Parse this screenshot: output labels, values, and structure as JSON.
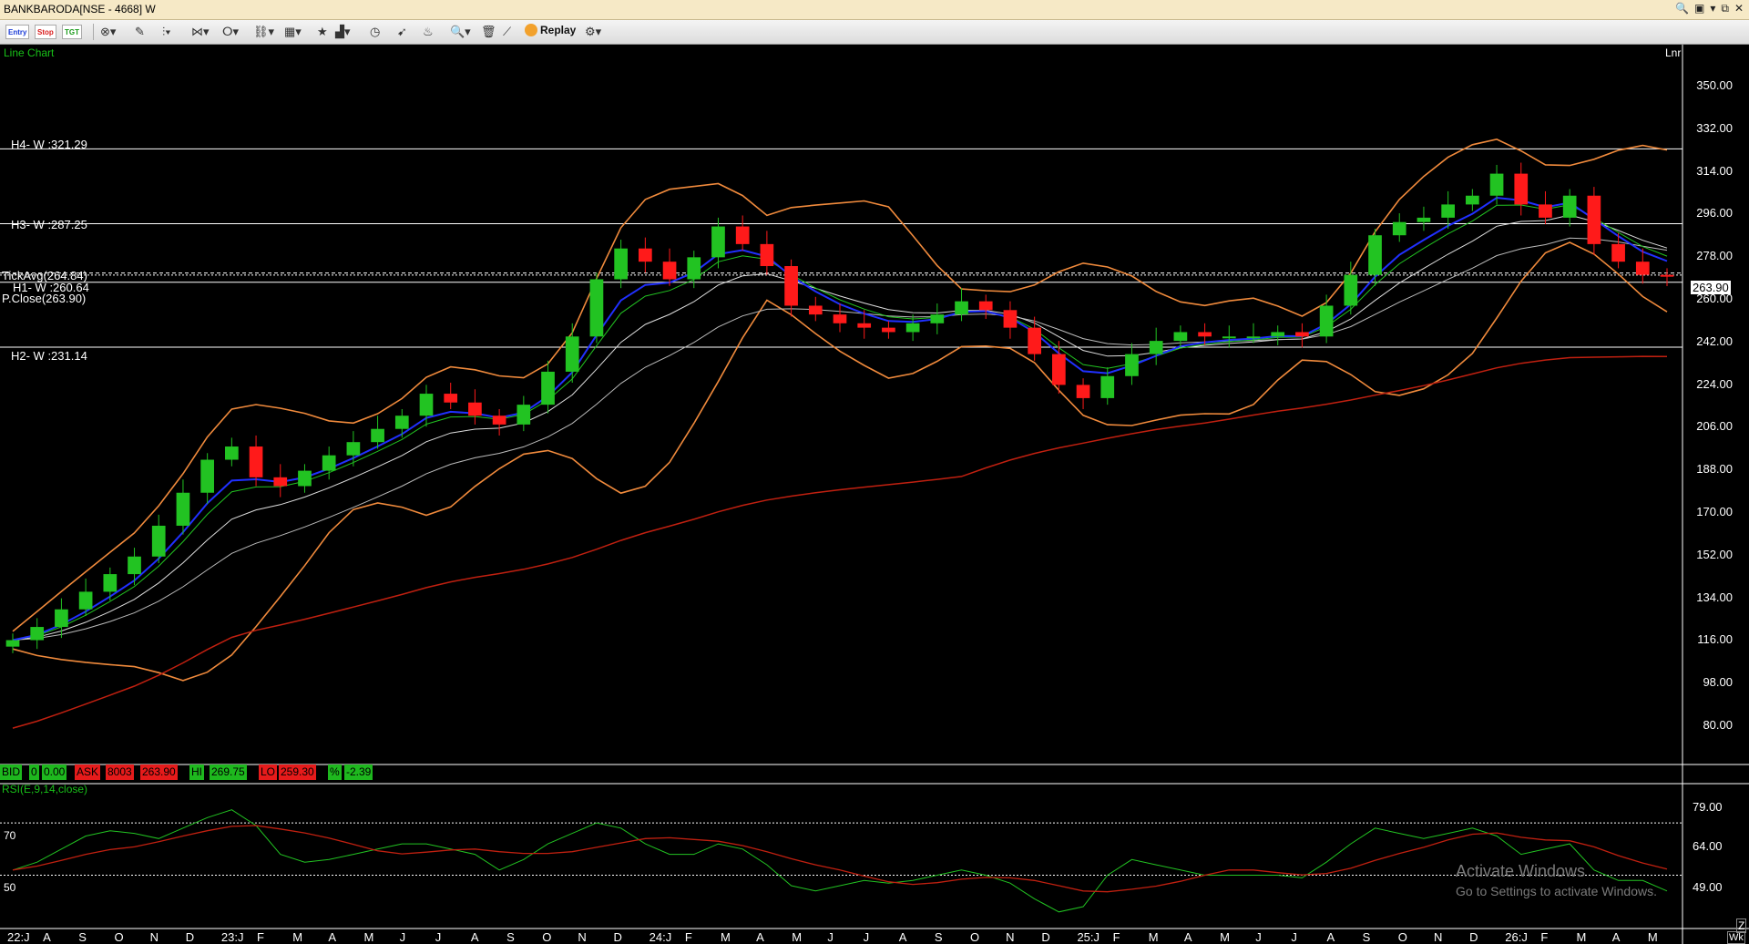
{
  "window": {
    "title": "BANKBARODA[NSE - 4668] W",
    "controls": [
      "🔍",
      "▣",
      "▾",
      "⧉",
      "✕"
    ]
  },
  "toolbar": {
    "entry_label": "Entry",
    "stop_label": "Stop",
    "tgt_label": "TGT",
    "replay_label": "Replay",
    "icons": [
      "money-icon",
      "pencil-icon",
      "drawing-icon",
      "lines-icon",
      "pattern-icon",
      "link-icon",
      "layout-icon",
      "star-icon",
      "indicator-icon",
      "clock-icon",
      "alert-icon",
      "zoom-icon",
      "delete-icon",
      "chart-type-icon",
      "replay-icon",
      "settings-icon"
    ]
  },
  "chart": {
    "type_label": "Line Chart",
    "scale_label": "Lnr",
    "levels": {
      "h4": "H4- W :321.29",
      "h3": "H3- W :287.25",
      "tickavg": "TickAvg(264.84)",
      "h1": "H1- W :260.64",
      "pclose": "P.Close(263.90)",
      "h2": "H2- W :231.14"
    },
    "last_price": "263.90",
    "y_ticks": [
      "350.00",
      "332.00",
      "314.00",
      "296.00",
      "278.00",
      "260.00",
      "242.00",
      "224.00",
      "206.00",
      "188.00",
      "170.00",
      "152.00",
      "134.00",
      "116.00",
      "98.00",
      "80.00"
    ],
    "x_ticks": [
      "22:J",
      "A",
      "S",
      "O",
      "N",
      "D",
      "23:J",
      "F",
      "M",
      "A",
      "M",
      "J",
      "J",
      "A",
      "S",
      "O",
      "N",
      "D",
      "24:J",
      "F",
      "M",
      "A",
      "M",
      "J",
      "J",
      "A",
      "S",
      "O",
      "N",
      "D",
      "25:J",
      "F",
      "M",
      "A",
      "M",
      "J",
      "J",
      "A",
      "S",
      "O",
      "N",
      "D",
      "26:J",
      "F",
      "M",
      "A",
      "M"
    ],
    "colors": {
      "up": "#22c322",
      "down": "#ff1a1a",
      "bollinger": "#f08a3c",
      "ema_blue": "#2030ff",
      "sma_red": "#c02010"
    }
  },
  "quote": {
    "bid_label": "BID",
    "bid_qty": "0",
    "bid_price": "0.00",
    "ask_label": "ASK",
    "ask_qty": "8003",
    "ask_price": "263.90",
    "hi_label": "HI",
    "hi": "269.75",
    "lo_label": "LO",
    "lo": "259.30",
    "pct_label": "%",
    "pct": "-2.39"
  },
  "rsi": {
    "label": "RSI(E,9,14,close)",
    "level_70": "70",
    "level_50": "50",
    "y_ticks": [
      "79.00",
      "64.00",
      "49.00"
    ]
  },
  "watermark": {
    "line1": "Activate Windows",
    "line2": "Go to Settings to activate Windows."
  },
  "corner": {
    "z": "Z",
    "wk": "Wk"
  },
  "chart_data": {
    "type": "candlestick",
    "title": "BANKBARODA[NSE - 4668] W",
    "ylim": [
      62,
      364
    ],
    "series": [
      {
        "name": "close",
        "values": [
          98,
          104,
          112,
          120,
          128,
          136,
          150,
          165,
          180,
          186,
          172,
          168,
          175,
          182,
          188,
          194,
          200,
          210,
          206,
          200,
          196,
          205,
          220,
          236,
          262,
          276,
          270,
          262,
          272,
          286,
          278,
          268,
          250,
          246,
          242,
          240,
          238,
          242,
          246,
          252,
          248,
          240,
          228,
          214,
          208,
          218,
          228,
          234,
          238,
          236,
          236,
          236,
          238,
          236,
          250,
          264,
          282,
          288,
          290,
          296,
          300,
          310,
          296,
          290,
          300,
          278,
          270,
          264,
          263.9
        ]
      }
    ],
    "rsi_values": [
      52,
      55,
      60,
      65,
      67,
      66,
      64,
      68,
      72,
      75,
      69,
      58,
      55,
      56,
      58,
      60,
      62,
      62,
      60,
      58,
      52,
      56,
      62,
      66,
      70,
      68,
      62,
      58,
      58,
      62,
      60,
      54,
      46,
      44,
      46,
      48,
      47,
      48,
      50,
      52,
      50,
      47,
      41,
      36,
      38,
      50,
      56,
      54,
      52,
      50,
      50,
      50,
      50,
      49,
      55,
      62,
      68,
      66,
      64,
      66,
      68,
      65,
      58,
      60,
      62,
      52,
      48,
      48,
      44
    ]
  }
}
